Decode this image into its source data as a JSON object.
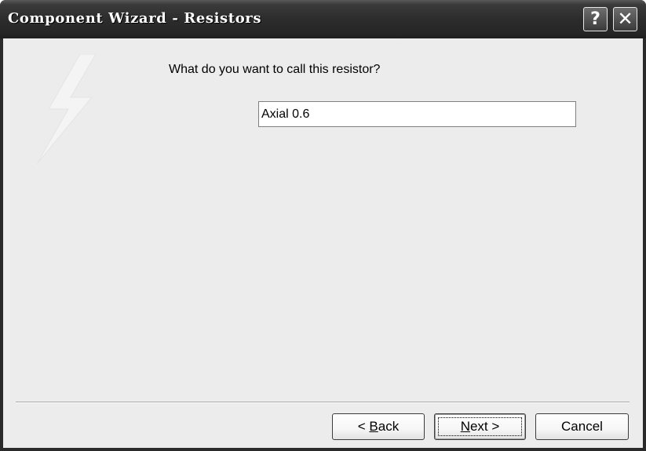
{
  "window": {
    "title": "Component Wizard - Resistors",
    "help_glyph": "?",
    "close_glyph": "✕"
  },
  "content": {
    "prompt": "What do you want to call this resistor?",
    "name_value": "Axial 0.6"
  },
  "buttons": {
    "back": {
      "prefix": "< ",
      "mnemonic": "B",
      "rest": "ack"
    },
    "next": {
      "mnemonic": "N",
      "rest": "ext >"
    },
    "cancel": {
      "label": "Cancel"
    }
  },
  "colors": {
    "titlebar": "#2c2c2c",
    "client_bg": "#ececec"
  }
}
